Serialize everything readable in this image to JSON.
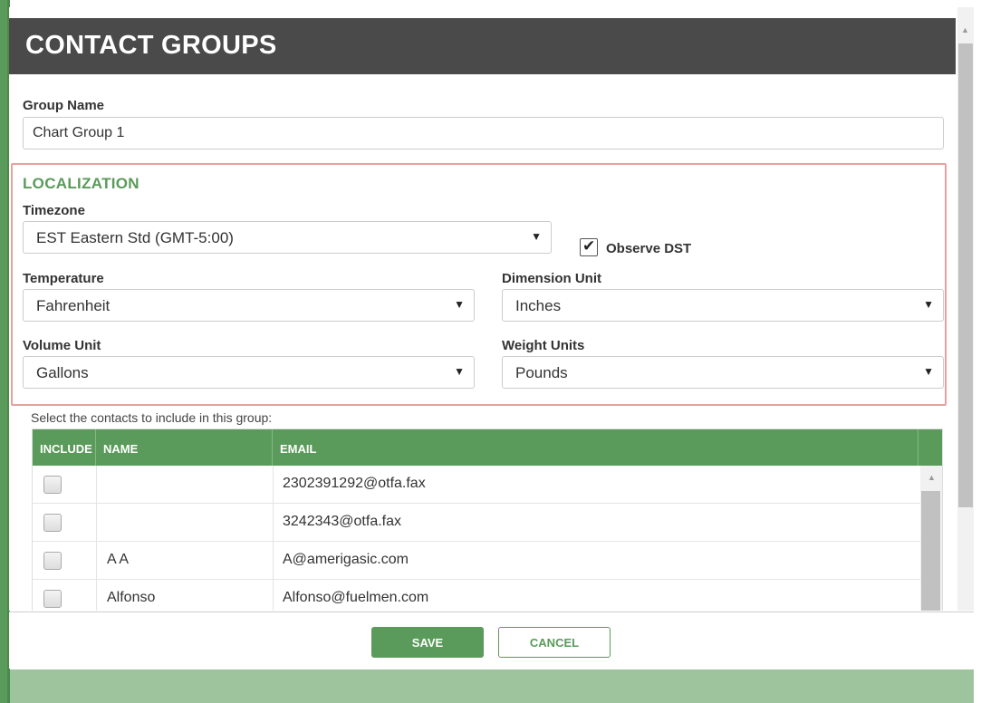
{
  "modal": {
    "title": "CONTACT GROUPS",
    "group_name_label": "Group Name",
    "group_name_value": "Chart Group 1"
  },
  "localization": {
    "title": "LOCALIZATION",
    "timezone_label": "Timezone",
    "timezone_value": "EST Eastern Std (GMT-5:00)",
    "observe_dst_label": "Observe DST",
    "observe_dst_checked": true,
    "temperature_label": "Temperature",
    "temperature_value": "Fahrenheit",
    "dimension_label": "Dimension Unit",
    "dimension_value": "Inches",
    "volume_label": "Volume Unit",
    "volume_value": "Gallons",
    "weight_label": "Weight Units",
    "weight_value": "Pounds"
  },
  "contacts": {
    "hint": "Select the contacts to include in this group:",
    "columns": [
      "INCLUDE",
      "NAME",
      "EMAIL"
    ],
    "rows": [
      {
        "name": "",
        "email": "2302391292@otfa.fax",
        "included": false
      },
      {
        "name": "",
        "email": "3242343@otfa.fax",
        "included": false
      },
      {
        "name": "A A",
        "email": "A@amerigasic.com",
        "included": false
      },
      {
        "name": "Alfonso",
        "email": "Alfonso@fuelmen.com",
        "included": false
      }
    ]
  },
  "footer": {
    "save_label": "SAVE",
    "cancel_label": "CANCEL"
  },
  "colors": {
    "accent_green": "#5a9a5a",
    "title_bar": "#4a4a4a",
    "localization_border": "#e8a0a0"
  },
  "icons": {
    "dropdown": "caret-down-icon",
    "scroll_up": "scroll-up-arrow-icon",
    "checkmark": "check-icon"
  }
}
